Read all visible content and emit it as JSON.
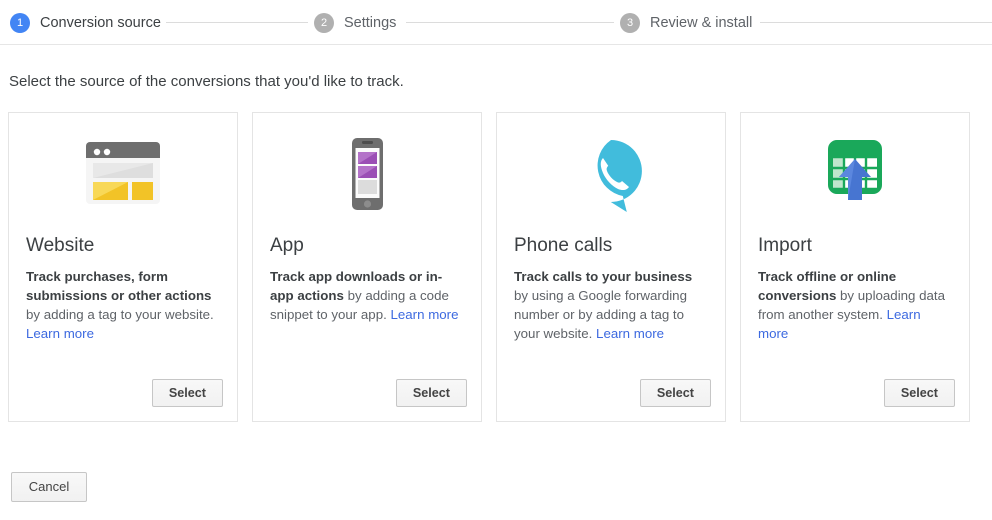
{
  "stepper": {
    "steps": [
      {
        "number": "1",
        "label": "Conversion source",
        "state": "active"
      },
      {
        "number": "2",
        "label": "Settings",
        "state": "inactive"
      },
      {
        "number": "3",
        "label": "Review & install",
        "state": "inactive"
      }
    ]
  },
  "instruction": "Select the source of the conversions that you'd like to track.",
  "cards": [
    {
      "icon": "browser-window-icon",
      "title": "Website",
      "body_bold": "Track purchases, form submissions or other actions",
      "body_rest": " by adding a tag to your website. ",
      "learn_more": "Learn more",
      "select_label": "Select"
    },
    {
      "icon": "mobile-phone-icon",
      "title": "App",
      "body_bold": "Track app downloads or in-app actions",
      "body_rest": " by adding a code snippet to your app. ",
      "learn_more": "Learn more",
      "select_label": "Select"
    },
    {
      "icon": "phone-speech-bubble-icon",
      "title": "Phone calls",
      "body_bold": "Track calls to your business",
      "body_rest": " by using a Google forwarding number or by adding a tag to your website. ",
      "learn_more": "Learn more",
      "select_label": "Select"
    },
    {
      "icon": "spreadsheet-upload-icon",
      "title": "Import",
      "body_bold": "Track offline or online conversions",
      "body_rest": " by uploading data from another system. ",
      "learn_more": "Learn more",
      "select_label": "Select"
    }
  ],
  "footer": {
    "cancel_label": "Cancel"
  },
  "colors": {
    "active_step": "#4285f4",
    "inactive_step": "#b0b0b0",
    "link": "#3d6ae0",
    "website_accent": "#f5cd33",
    "app_accent": "#a854c0",
    "phone_accent": "#41bcdc",
    "import_accent": "#1aa85a",
    "import_arrow": "#4775d1"
  }
}
